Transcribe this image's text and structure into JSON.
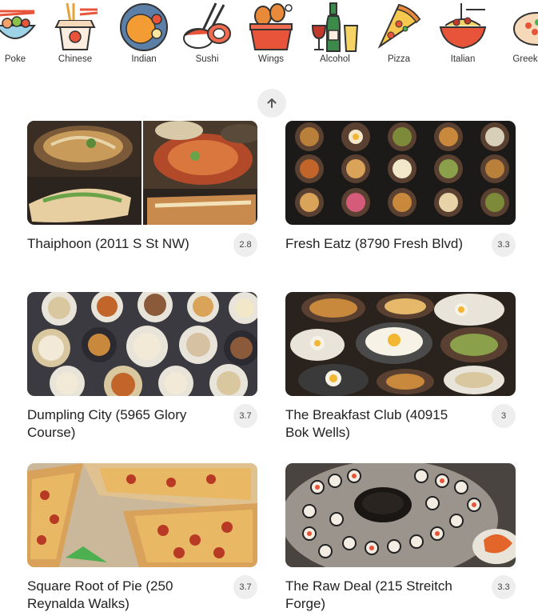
{
  "categories": [
    {
      "label": "Poke",
      "icon": "poke-bowl-icon"
    },
    {
      "label": "Chinese",
      "icon": "takeout-box-icon"
    },
    {
      "label": "Indian",
      "icon": "curry-plate-icon"
    },
    {
      "label": "Sushi",
      "icon": "sushi-icon"
    },
    {
      "label": "Wings",
      "icon": "chicken-wings-icon"
    },
    {
      "label": "Alcohol",
      "icon": "wine-bottle-icon"
    },
    {
      "label": "Pizza",
      "icon": "pizza-slice-icon"
    },
    {
      "label": "Italian",
      "icon": "spaghetti-icon"
    },
    {
      "label": "Greek",
      "icon": "greek-plate-icon"
    }
  ],
  "scroll_up_icon": "arrow-up-icon",
  "restaurants": [
    {
      "name": "Thaiphoon (2011 S St NW)",
      "rating": "2.8"
    },
    {
      "name": "Fresh Eatz (8790 Fresh Blvd)",
      "rating": "3.3"
    },
    {
      "name": "Dumpling City (5965 Glory Course)",
      "rating": "3.7"
    },
    {
      "name": "The Breakfast Club (40915 Bok Wells)",
      "rating": "3"
    },
    {
      "name": "Square Root of Pie (250 Reynalda Walks)",
      "rating": "3.7"
    },
    {
      "name": "The Raw Deal (215 Streitch Forge)",
      "rating": "3.3"
    }
  ],
  "colors": {
    "accent": "#e8543a",
    "badge_bg": "#eeeeee"
  }
}
